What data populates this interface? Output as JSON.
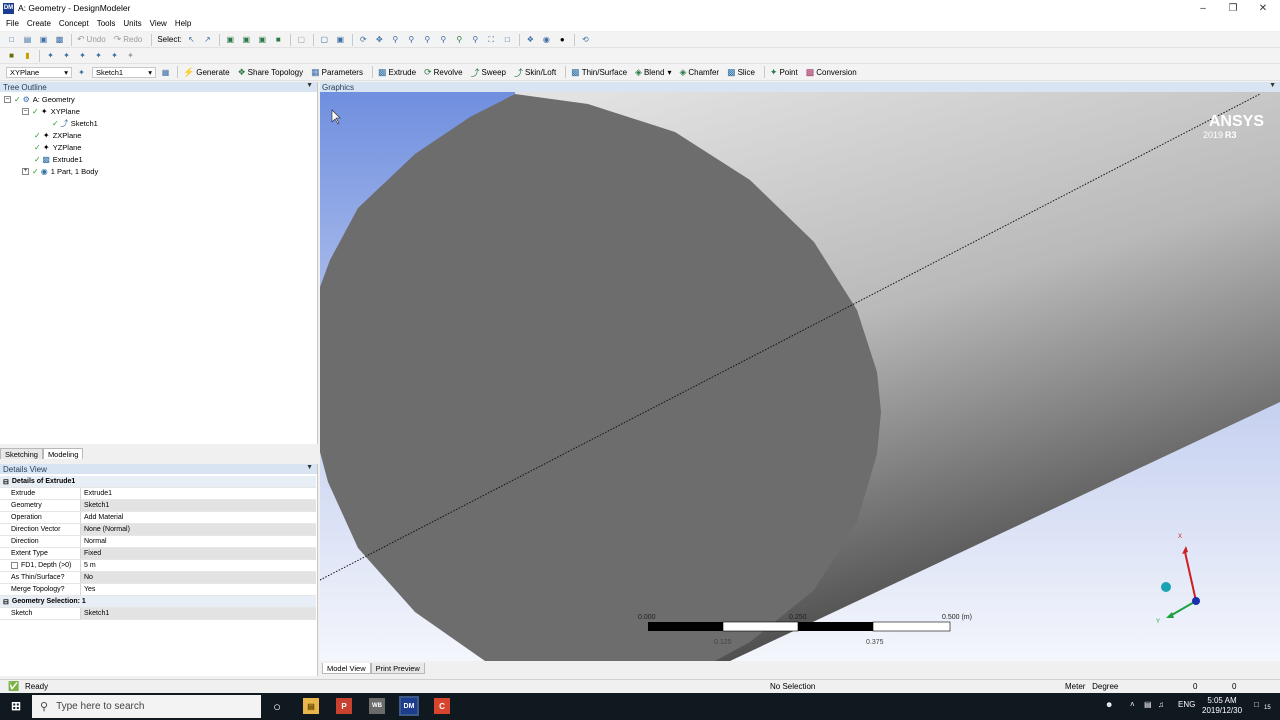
{
  "window": {
    "title": "A: Geometry - DesignModeler",
    "app_badge": "DM"
  },
  "menu": [
    "File",
    "Create",
    "Concept",
    "Tools",
    "Units",
    "View",
    "Help"
  ],
  "toolbar1": {
    "undo": "Undo",
    "redo": "Redo",
    "select_label": "Select:"
  },
  "toolbar3": {
    "plane_select": "XYPlane",
    "sketch_select": "Sketch1",
    "buttons": [
      "Generate",
      "Share Topology",
      "Parameters",
      "Extrude",
      "Revolve",
      "Sweep",
      "Skin/Loft",
      "Thin/Surface",
      "Blend",
      "Chamfer",
      "Slice",
      "Point",
      "Conversion"
    ]
  },
  "tree": {
    "header": "Tree Outline",
    "nodes": [
      "A: Geometry",
      "XYPlane",
      "Sketch1",
      "ZXPlane",
      "YZPlane",
      "Extrude1",
      "1 Part, 1 Body"
    ]
  },
  "tabs": {
    "sketching": "Sketching",
    "modeling": "Modeling"
  },
  "details": {
    "header": "Details View",
    "group1": "Details of Extrude1",
    "rows": [
      {
        "k": "Extrude",
        "v": "Extrude1"
      },
      {
        "k": "Geometry",
        "v": "Sketch1"
      },
      {
        "k": "Operation",
        "v": "Add Material"
      },
      {
        "k": "Direction Vector",
        "v": "None (Normal)"
      },
      {
        "k": "Direction",
        "v": "Normal"
      },
      {
        "k": "Extent Type",
        "v": "Fixed"
      },
      {
        "k": "FD1, Depth (>0)",
        "v": "5 m"
      },
      {
        "k": "As Thin/Surface?",
        "v": "No"
      },
      {
        "k": "Merge Topology?",
        "v": "Yes"
      }
    ],
    "group2": "Geometry Selection: 1",
    "rows2": [
      {
        "k": "Sketch",
        "v": "Sketch1"
      }
    ]
  },
  "graphics": {
    "header": "Graphics",
    "brand": "ANSYS",
    "version_prefix": "2019",
    "version_suffix": "R3",
    "scale_top": [
      "0.000",
      "0.250",
      "0.500 (m)"
    ],
    "scale_bottom": [
      "0.125",
      "0.375"
    ],
    "axis_x": "X",
    "axis_y": "Y"
  },
  "view_tabs": {
    "model": "Model View",
    "print": "Print Preview"
  },
  "status": {
    "ready": "Ready",
    "selection": "No Selection",
    "units": "Meter   Degree",
    "v1": "0",
    "v2": "0"
  },
  "taskbar": {
    "search_placeholder": "Type here to search",
    "lang": "ENG",
    "time": "5:05 AM",
    "date": "2019/12/30",
    "notif_count": "15"
  },
  "colors": {
    "accent": "#3a6ea5",
    "panel_header": "#d8e4f1",
    "circle": "#6d6d6d",
    "taskbar": "#101820"
  }
}
